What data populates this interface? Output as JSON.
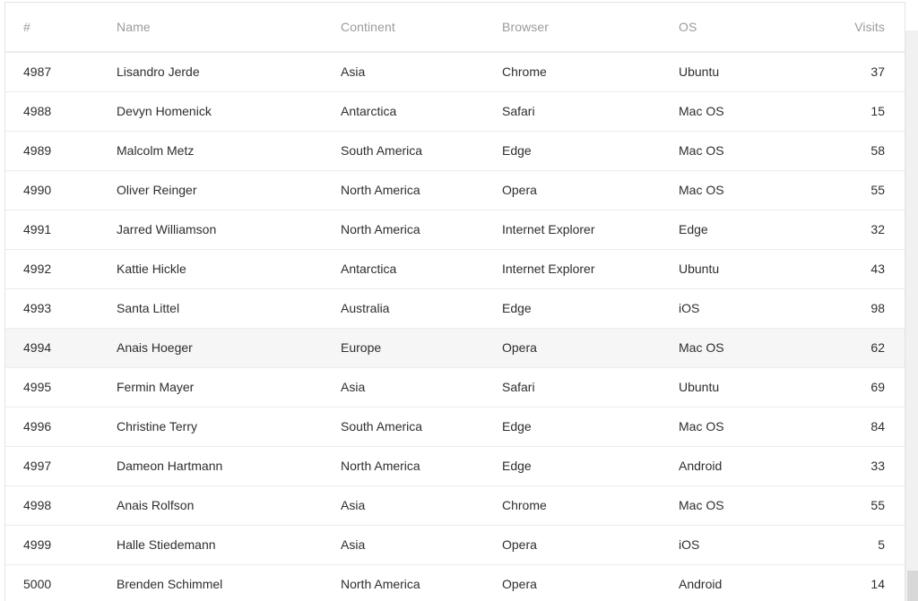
{
  "table": {
    "columns": [
      {
        "key": "id",
        "label": "#",
        "align": "left"
      },
      {
        "key": "name",
        "label": "Name",
        "align": "left"
      },
      {
        "key": "continent",
        "label": "Continent",
        "align": "left"
      },
      {
        "key": "browser",
        "label": "Browser",
        "align": "left"
      },
      {
        "key": "os",
        "label": "OS",
        "align": "left"
      },
      {
        "key": "visits",
        "label": "Visits",
        "align": "right"
      }
    ],
    "rows": [
      {
        "id": "4987",
        "name": "Lisandro Jerde",
        "continent": "Asia",
        "browser": "Chrome",
        "os": "Ubuntu",
        "visits": "37",
        "highlighted": false
      },
      {
        "id": "4988",
        "name": "Devyn Homenick",
        "continent": "Antarctica",
        "browser": "Safari",
        "os": "Mac OS",
        "visits": "15",
        "highlighted": false
      },
      {
        "id": "4989",
        "name": "Malcolm Metz",
        "continent": "South America",
        "browser": "Edge",
        "os": "Mac OS",
        "visits": "58",
        "highlighted": false
      },
      {
        "id": "4990",
        "name": "Oliver Reinger",
        "continent": "North America",
        "browser": "Opera",
        "os": "Mac OS",
        "visits": "55",
        "highlighted": false
      },
      {
        "id": "4991",
        "name": "Jarred Williamson",
        "continent": "North America",
        "browser": "Internet Explorer",
        "os": "Edge",
        "visits": "32",
        "highlighted": false
      },
      {
        "id": "4992",
        "name": "Kattie Hickle",
        "continent": "Antarctica",
        "browser": "Internet Explorer",
        "os": "Ubuntu",
        "visits": "43",
        "highlighted": false
      },
      {
        "id": "4993",
        "name": "Santa Littel",
        "continent": "Australia",
        "browser": "Edge",
        "os": "iOS",
        "visits": "98",
        "highlighted": false
      },
      {
        "id": "4994",
        "name": "Anais Hoeger",
        "continent": "Europe",
        "browser": "Opera",
        "os": "Mac OS",
        "visits": "62",
        "highlighted": true
      },
      {
        "id": "4995",
        "name": "Fermin Mayer",
        "continent": "Asia",
        "browser": "Safari",
        "os": "Ubuntu",
        "visits": "69",
        "highlighted": false
      },
      {
        "id": "4996",
        "name": "Christine Terry",
        "continent": "South America",
        "browser": "Edge",
        "os": "Mac OS",
        "visits": "84",
        "highlighted": false
      },
      {
        "id": "4997",
        "name": "Dameon Hartmann",
        "continent": "North America",
        "browser": "Edge",
        "os": "Android",
        "visits": "33",
        "highlighted": false
      },
      {
        "id": "4998",
        "name": "Anais Rolfson",
        "continent": "Asia",
        "browser": "Chrome",
        "os": "Mac OS",
        "visits": "55",
        "highlighted": false
      },
      {
        "id": "4999",
        "name": "Halle Stiedemann",
        "continent": "Asia",
        "browser": "Opera",
        "os": "iOS",
        "visits": "5",
        "highlighted": false
      },
      {
        "id": "5000",
        "name": "Brenden Schimmel",
        "continent": "North America",
        "browser": "Opera",
        "os": "Android",
        "visits": "14",
        "highlighted": false
      }
    ]
  },
  "colors": {
    "header_text": "#9b9b9b",
    "body_text": "#2e2e2e",
    "row_border": "#ececec",
    "header_border": "#ececec",
    "table_border": "#e4e4e4",
    "row_highlight_bg": "#f6f6f6",
    "scrollbar_track": "#f1f1f1",
    "scrollbar_thumb": "#d8d8d8",
    "background": "#ffffff"
  },
  "scrollbar": {
    "orientation": "vertical",
    "thumb_position": "bottom"
  }
}
